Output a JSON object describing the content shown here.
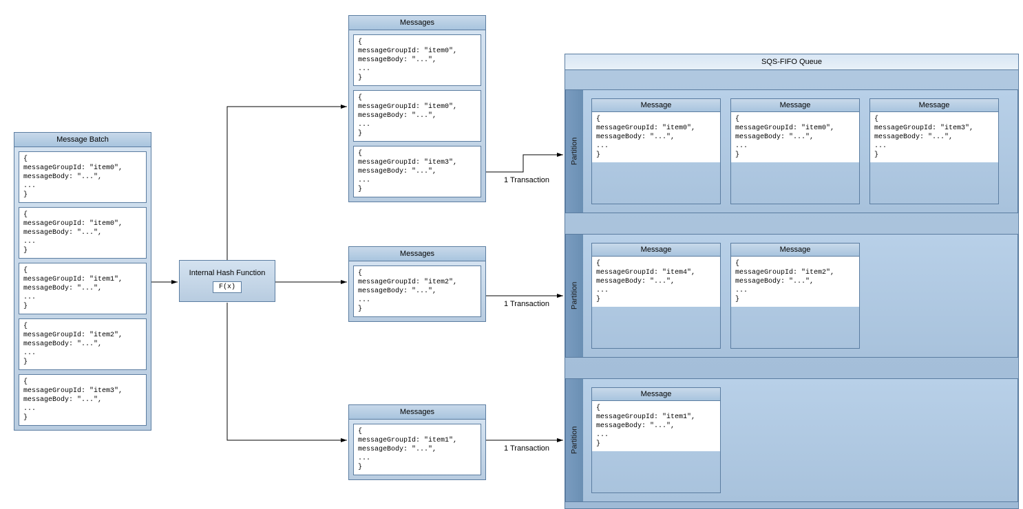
{
  "messageBatch": {
    "title": "Message Batch",
    "items": [
      "{\nmessageGroupId: \"item0\",\nmessageBody: \"...\",\n...\n}",
      "{\nmessageGroupId: \"item0\",\nmessageBody: \"...\",\n...\n}",
      "{\nmessageGroupId: \"item1\",\nmessageBody: \"...\",\n...\n}",
      "{\nmessageGroupId: \"item2\",\nmessageBody: \"...\",\n...\n}",
      "{\nmessageGroupId: \"item3\",\nmessageBody: \"...\",\n...\n}"
    ]
  },
  "hashFunction": {
    "label": "Internal Hash Function",
    "formula": "F(x)"
  },
  "messageGroups": [
    {
      "title": "Messages",
      "items": [
        "{\nmessageGroupId: \"item0\",\nmessageBody: \"...\",\n...\n}",
        "{\nmessageGroupId: \"item0\",\nmessageBody: \"...\",\n...\n}",
        "{\nmessageGroupId: \"item3\",\nmessageBody: \"...\",\n...\n}"
      ],
      "arrowLabel": "1 Transaction"
    },
    {
      "title": "Messages",
      "items": [
        "{\nmessageGroupId: \"item2\",\nmessageBody: \"...\",\n...\n}"
      ],
      "arrowLabel": "1 Transaction"
    },
    {
      "title": "Messages",
      "items": [
        "{\nmessageGroupId: \"item1\",\nmessageBody: \"...\",\n...\n}"
      ],
      "arrowLabel": "1 Transaction"
    }
  ],
  "queue": {
    "title": "SQS-FIFO Queue",
    "partitions": [
      {
        "label": "Partition",
        "messages": [
          {
            "title": "Message",
            "body": "{\nmessageGroupId: \"item0\",\nmessageBody: \"...\",\n...\n}"
          },
          {
            "title": "Message",
            "body": "{\nmessageGroupId: \"item0\",\nmessageBody: \"...\",\n...\n}"
          },
          {
            "title": "Message",
            "body": "{\nmessageGroupId: \"item3\",\nmessageBody: \"...\",\n...\n}"
          }
        ]
      },
      {
        "label": "Partition",
        "messages": [
          {
            "title": "Message",
            "body": "{\nmessageGroupId: \"item4\",\nmessageBody: \"...\",\n...\n}"
          },
          {
            "title": "Message",
            "body": "{\nmessageGroupId: \"item2\",\nmessageBody: \"...\",\n...\n}"
          }
        ]
      },
      {
        "label": "Partition",
        "messages": [
          {
            "title": "Message",
            "body": "{\nmessageGroupId: \"item1\",\nmessageBody: \"...\",\n...\n}"
          }
        ]
      }
    ]
  }
}
